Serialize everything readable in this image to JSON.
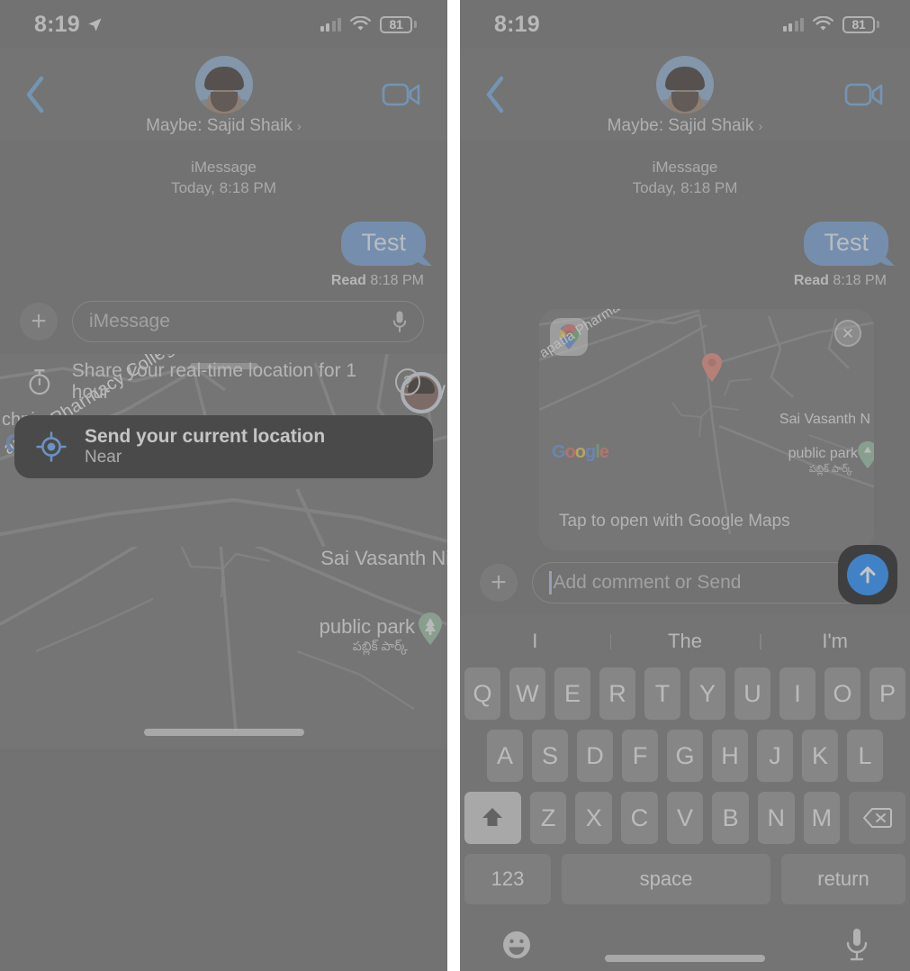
{
  "status_bar": {
    "time": "8:19",
    "battery": "81",
    "icons": [
      "location-arrow-icon",
      "cellular-signal-icon",
      "wifi-icon",
      "battery-icon"
    ]
  },
  "nav": {
    "back_label": "‹",
    "contact_name": "Maybe: Sajid Shaik",
    "chevron": "›",
    "video_label": "facetime-video-button"
  },
  "conversation": {
    "service": "iMessage",
    "timestamp": "Today, 8:18 PM",
    "messages": [
      {
        "text": "Test",
        "direction": "outgoing",
        "receipt_status": "Read",
        "receipt_time": "8:18 PM"
      }
    ],
    "receipt_full": "Read 8:18 PM"
  },
  "composer_left": {
    "plus": "+",
    "placeholder": "iMessage",
    "mic": "mic-icon"
  },
  "composer_right": {
    "plus": "+",
    "placeholder": "Add comment or Send",
    "send_label": "send-button"
  },
  "map_sheet": {
    "grabber": "drag-handle",
    "labels": {
      "polytechnic": "chnic",
      "road": "apatla Pharmacy College Rd",
      "watermark": [
        "G",
        "o",
        "o",
        "g",
        "l",
        "e"
      ],
      "residency": "Sai Vasanth Nil",
      "park": "public park",
      "park_local": "పబ్లిక్ పార్క్",
      "edge_right": "W"
    },
    "share_realtime": "Share your real-time location for 1 hour",
    "help": "?",
    "send_current_title": "Send your current location",
    "send_current_subtitle": "Near"
  },
  "attachment_card": {
    "app_badge": "google-maps-icon",
    "close": "✕",
    "caption": "Tap to open with Google Maps",
    "labels": {
      "road": "apatla Pharmacy College Rd",
      "watermark": [
        "G",
        "o",
        "o",
        "g",
        "l",
        "e"
      ],
      "residency": "Sai Vasanth N",
      "park": "public park",
      "park_local": "పబ్లిక్ పార్క్"
    }
  },
  "keyboard": {
    "predictions": [
      "I",
      "The",
      "I'm"
    ],
    "row1": [
      "Q",
      "W",
      "E",
      "R",
      "T",
      "Y",
      "U",
      "I",
      "O",
      "P"
    ],
    "row2": [
      "A",
      "S",
      "D",
      "F",
      "G",
      "H",
      "J",
      "K",
      "L"
    ],
    "row3": [
      "Z",
      "X",
      "C",
      "V",
      "B",
      "N",
      "M"
    ],
    "shift": "shift-key",
    "backspace": "backspace-key",
    "numbers": "123",
    "space": "space",
    "return": "return",
    "emoji": "emoji-key",
    "dictation": "dictation-mic-key"
  },
  "colors": {
    "accent_blue": "#0a84ff",
    "bubble_blue": "#6b9ad2",
    "tint": "#5b8fd6",
    "pill_dark": "#1c1c1e",
    "background": "#666666"
  }
}
